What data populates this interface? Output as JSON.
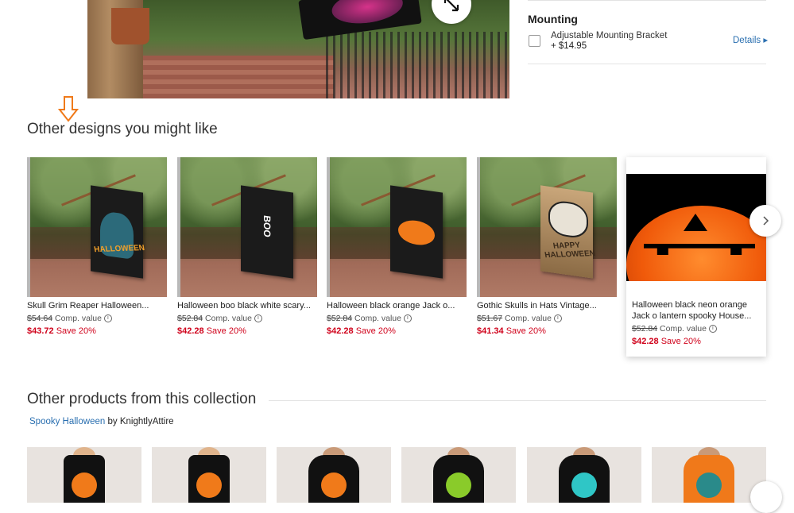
{
  "mounting": {
    "title": "Mounting",
    "option_label": "Adjustable Mounting Bracket",
    "option_price": "+ $14.95",
    "details_label": "Details ▸"
  },
  "related": {
    "title": "Other designs you might like",
    "items": [
      {
        "title": "Skull Grim Reaper Halloween...",
        "old_price": "$54.64",
        "comp_label": "Comp. value",
        "price": "$43.72",
        "save": "Save 20%",
        "flag_text": "HALLOWEEN"
      },
      {
        "title": "Halloween boo black white scary...",
        "old_price": "$52.84",
        "comp_label": "Comp. value",
        "price": "$42.28",
        "save": "Save 20%",
        "flag_text": "BOO"
      },
      {
        "title": "Halloween black orange Jack o...",
        "old_price": "$52.84",
        "comp_label": "Comp. value",
        "price": "$42.28",
        "save": "Save 20%"
      },
      {
        "title": "Gothic Skulls in Hats Vintage...",
        "old_price": "$51.67",
        "comp_label": "Comp. value",
        "price": "$41.34",
        "save": "Save 20%",
        "flag_text": "HAPPY HALLOWEEN"
      },
      {
        "title": "Halloween black neon orange Jack o lantern spooky House...",
        "old_price": "$52.84",
        "comp_label": "Comp. value",
        "price": "$42.28",
        "save": "Save 20%"
      }
    ]
  },
  "collection": {
    "title": "Other products from this collection",
    "collection_name": "Spooky Halloween",
    "by_label": "by",
    "author": "KnightlyAttire"
  },
  "colors": {
    "accent_link": "#2a6fb0",
    "sale_red": "#d0021b",
    "arrow_orange": "#f07a1a"
  }
}
